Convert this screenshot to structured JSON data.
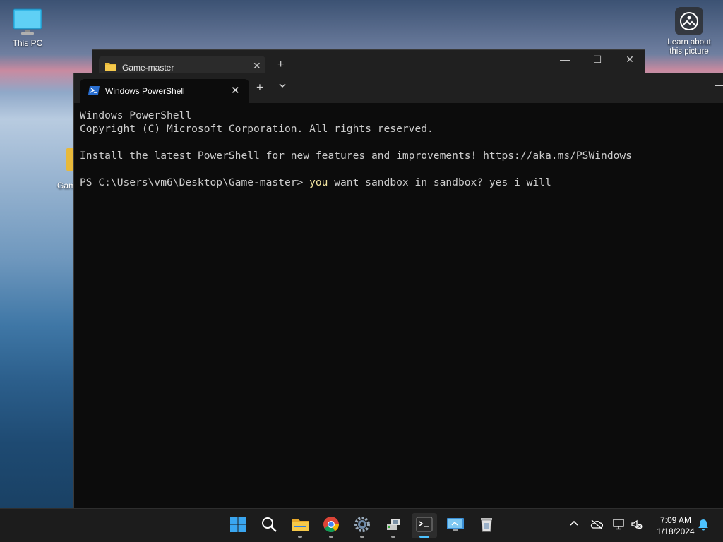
{
  "desktop": {
    "icons": [
      {
        "label": "This PC",
        "icon": "monitor-icon"
      },
      {
        "label": "Gam",
        "icon": "folder-icon"
      }
    ],
    "learn_about": {
      "label_line1": "Learn about",
      "label_line2": "this picture",
      "icon": "camera-icon"
    }
  },
  "explorer": {
    "tab_title": "Game-master",
    "close_glyph": "✕",
    "add_glyph": "+",
    "caption": {
      "minimize": "—",
      "maximize": "☐",
      "close": "✕"
    }
  },
  "terminal": {
    "tab_title": "Windows PowerShell",
    "close_glyph": "✕",
    "add_glyph": "+",
    "dropdown_glyph": "⌄",
    "minimize_glyph": "—",
    "lines": {
      "l1": "Windows PowerShell",
      "l2": "Copyright (C) Microsoft Corporation. All rights reserved.",
      "l3": "Install the latest PowerShell for new features and improvements! https://aka.ms/PSWindows",
      "prompt": "PS C:\\Users\\vm6\\Desktop\\Game-master> ",
      "cmd_keyword": "you",
      "cmd_rest": " want sandbox in sandbox? yes i will"
    }
  },
  "taskbar": {
    "items": [
      "start-icon",
      "search-icon",
      "file-explorer-icon",
      "chrome-icon",
      "settings-icon",
      "network-drive-icon",
      "terminal-icon",
      "remote-desktop-icon",
      "recycle-bin-icon"
    ],
    "tray": {
      "chevron": "^"
    },
    "clock": {
      "time": "7:09 AM",
      "date": "1/18/2024"
    }
  },
  "colors": {
    "accent": "#4cc2ff",
    "terminal_bg": "#0c0c0c",
    "titlebar": "#202020",
    "taskbar": "#1c1c1c"
  }
}
